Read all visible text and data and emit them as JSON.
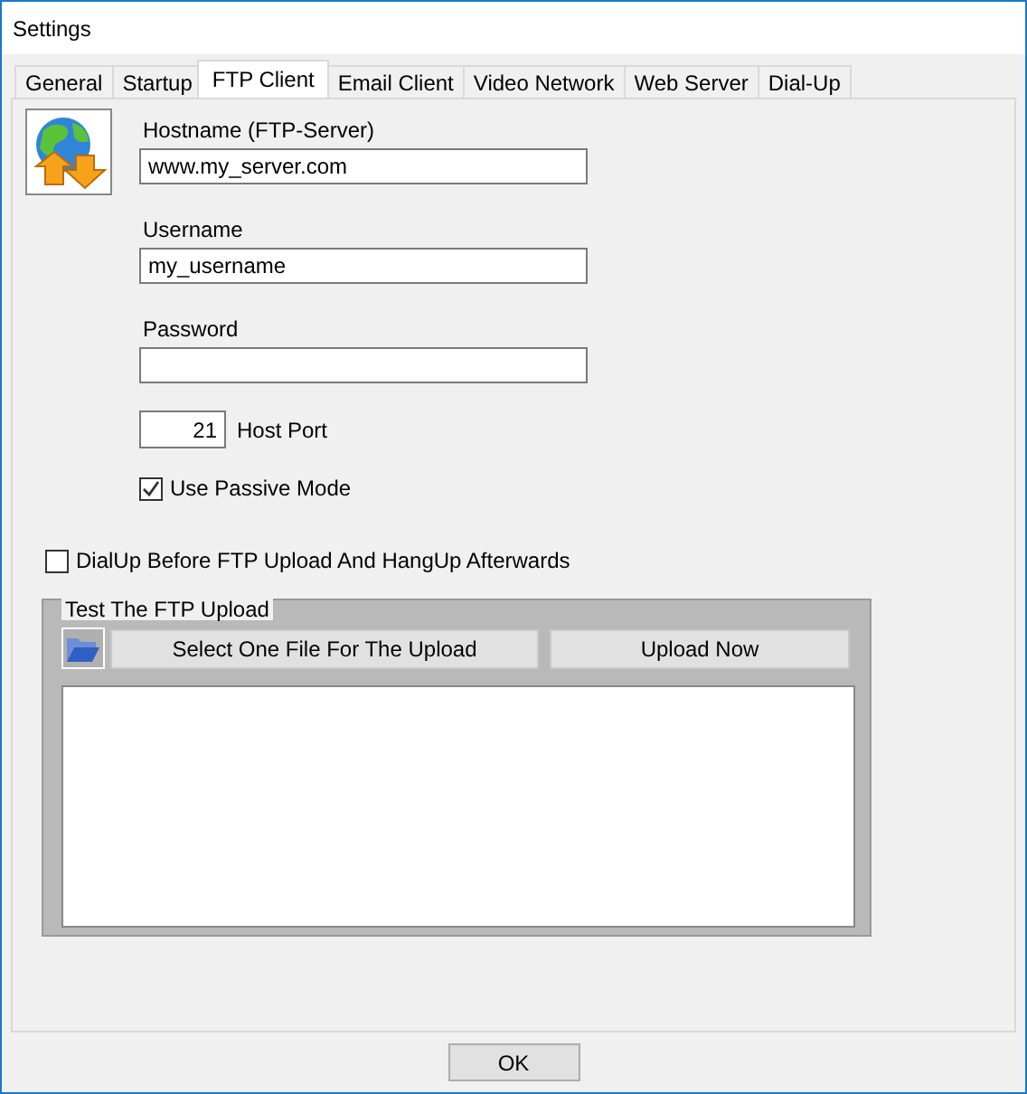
{
  "window": {
    "title": "Settings"
  },
  "tabs": [
    {
      "label": "General",
      "selected": false
    },
    {
      "label": "Startup",
      "selected": false
    },
    {
      "label": "FTP Client",
      "selected": true
    },
    {
      "label": "Email Client",
      "selected": false
    },
    {
      "label": "Video Network",
      "selected": false
    },
    {
      "label": "Web Server",
      "selected": false
    },
    {
      "label": "Dial-Up",
      "selected": false
    }
  ],
  "fields": [
    {
      "label": "Hostname (FTP-Server)",
      "value": "www.my_server.com"
    },
    {
      "label": "Username",
      "value": "my_username"
    },
    {
      "label": "Password"
    }
  ],
  "port": {
    "value": "21",
    "label": "Host Port"
  },
  "passive_mode": {
    "label": "Use Passive Mode",
    "checked": true
  },
  "dialup": {
    "label": "DialUp Before FTP Upload And HangUp Afterwards",
    "checked": false
  },
  "upload_group": {
    "title": "Test The FTP Upload",
    "select_button": "Select One File For The Upload",
    "upload_button": "Upload Now"
  },
  "buttons": [
    "OK"
  ]
}
